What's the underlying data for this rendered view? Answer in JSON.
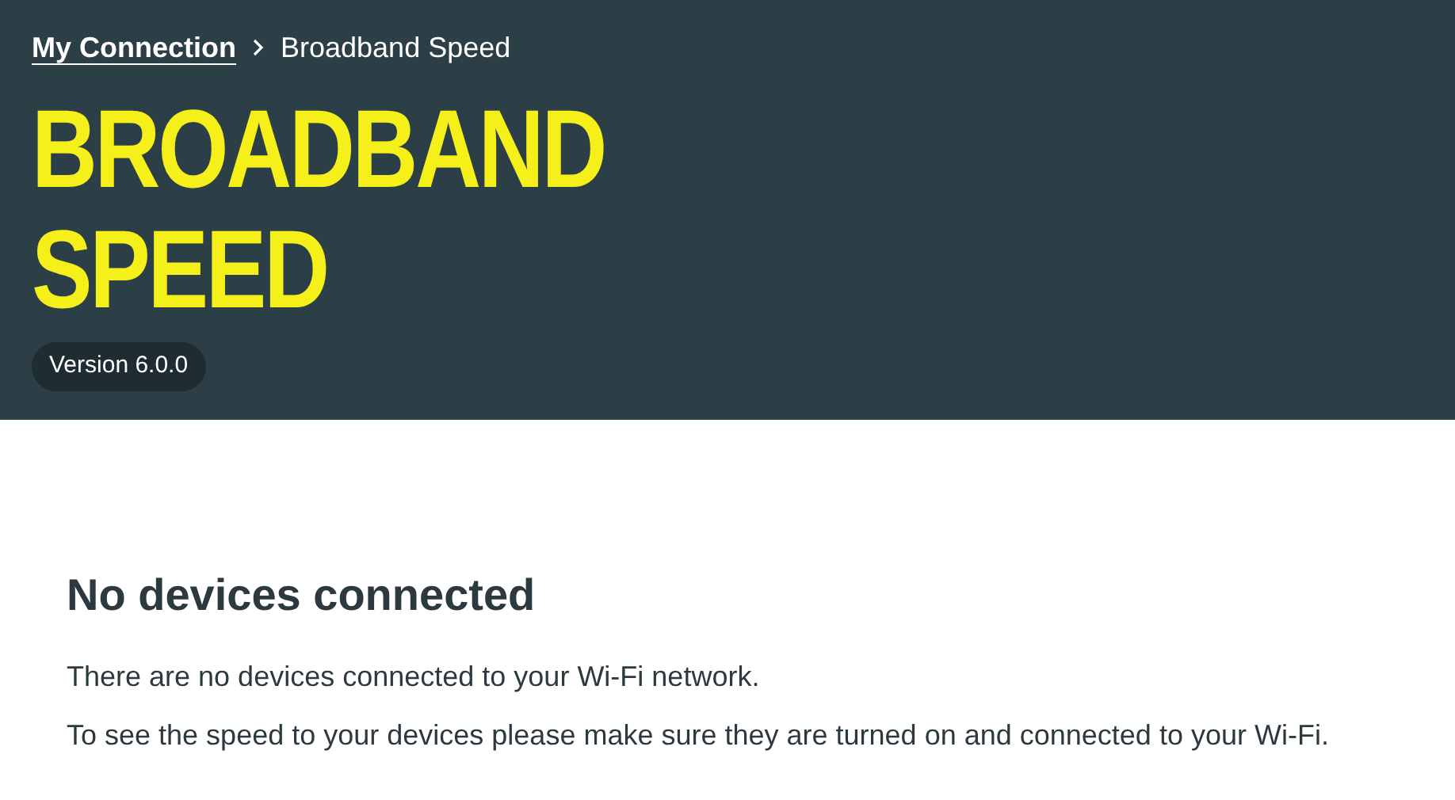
{
  "breadcrumb": [
    {
      "label": "My Connection",
      "kind": "link"
    },
    {
      "label": "Broadband Speed",
      "kind": "current"
    }
  ],
  "title_lines": [
    "BROADBAND",
    "SPEED"
  ],
  "version_badge": "Version 6.0.0",
  "message": {
    "heading": "No devices connected",
    "paragraphs": [
      "There are no devices connected to your Wi-Fi network.",
      "To see the speed to your devices please make sure they are turned on and connected to your Wi-Fi."
    ]
  }
}
